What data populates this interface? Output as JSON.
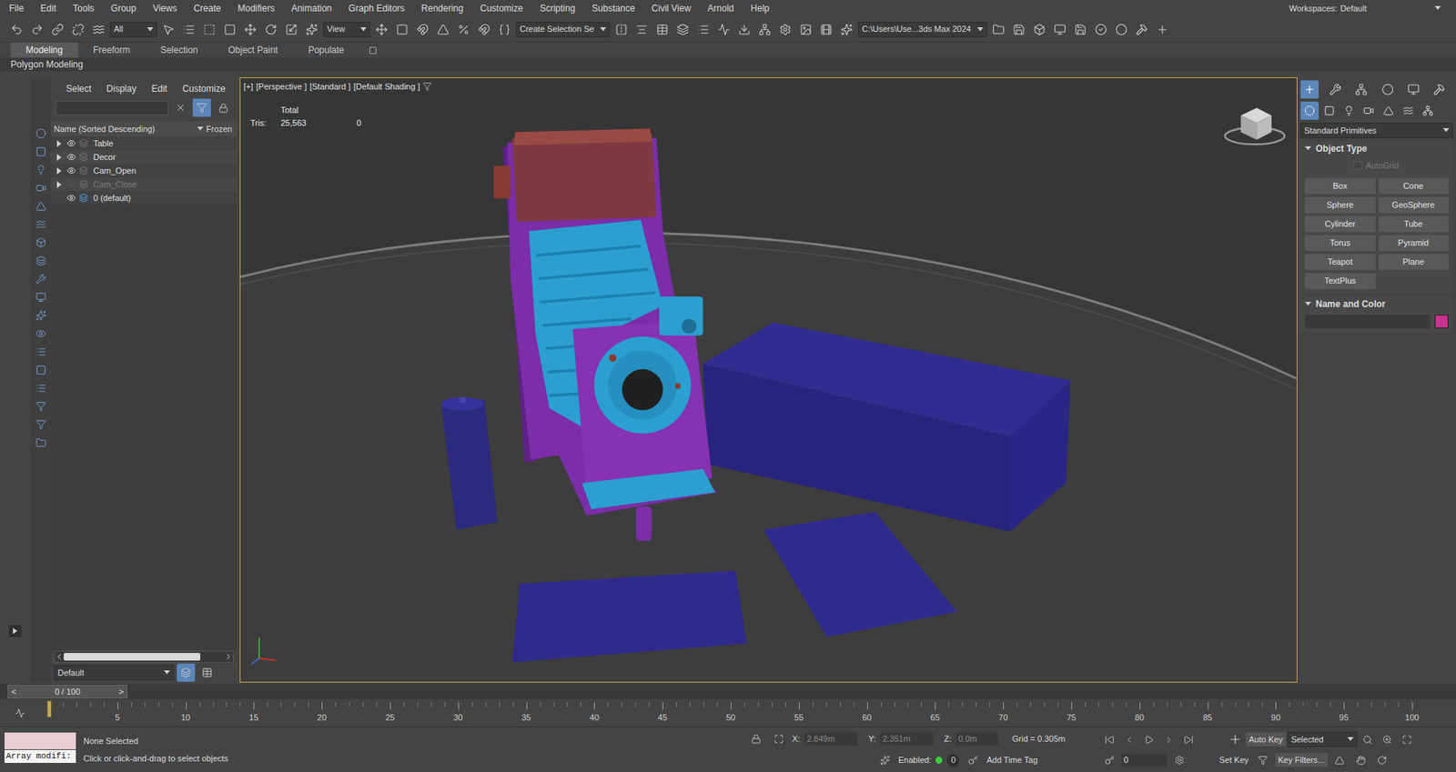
{
  "menu_bar": {
    "items": [
      "File",
      "Edit",
      "Tools",
      "Group",
      "Views",
      "Create",
      "Modifiers",
      "Animation",
      "Graph Editors",
      "Rendering",
      "Customize",
      "Scripting",
      "Substance",
      "Civil View",
      "Arnold",
      "Help"
    ],
    "workspaces_label": "Workspaces:",
    "workspace": "Default"
  },
  "toolbar": {
    "selection_filter": "All",
    "reference_coord": "View",
    "selection_set": "Create Selection Se",
    "project_path": "C:\\Users\\Use...3ds Max 2024"
  },
  "ribbon": {
    "tabs": [
      {
        "label": "Modeling",
        "selected": true
      },
      {
        "label": "Freeform",
        "selected": false
      },
      {
        "label": "Selection",
        "selected": false
      },
      {
        "label": "Object Paint",
        "selected": false
      },
      {
        "label": "Populate",
        "selected": false
      }
    ],
    "panel_label": "Polygon Modeling"
  },
  "scene_explorer": {
    "menu": [
      "Select",
      "Display",
      "Edit",
      "Customize"
    ],
    "search_value": "",
    "filter_active": true,
    "columns": [
      "Name (Sorted Descending)",
      "Frozen"
    ],
    "rows": [
      {
        "name": "Table",
        "kind": "object",
        "visible": true,
        "expandable": true,
        "expanded": false
      },
      {
        "name": "Decor",
        "kind": "object",
        "visible": true,
        "expandable": true,
        "expanded": false
      },
      {
        "name": "Cam_Open",
        "kind": "object",
        "visible": true,
        "expandable": true,
        "expanded": false
      },
      {
        "name": "Cam_Close",
        "kind": "object",
        "visible": false,
        "expandable": true,
        "expanded": false
      },
      {
        "name": "0 (default)",
        "kind": "layer",
        "visible": true,
        "expandable": false,
        "expanded": false
      }
    ],
    "layer_dropdown": "Default"
  },
  "viewport": {
    "labels": [
      "[+]",
      "[Perspective ]",
      "[Standard ]",
      "[Default Shading ]"
    ],
    "active": true,
    "stats": {
      "header": "Total",
      "label": "Tris:",
      "value": "25,563",
      "second_value": "0"
    }
  },
  "command_panel": {
    "category": "Standard Primitives",
    "object_type_title": "Object Type",
    "autogrid": {
      "label": "AutoGrid",
      "checked": false,
      "disabled": true
    },
    "buttons": [
      "Box",
      "Cone",
      "Sphere",
      "GeoSphere",
      "Cylinder",
      "Tube",
      "Torus",
      "Pyramid",
      "Teapot",
      "Plane",
      "TextPlus"
    ],
    "name_color_title": "Name and Color",
    "name_value": "",
    "color": "#c8318e"
  },
  "timeline": {
    "prev": "<",
    "position": "0 / 100",
    "next": ">",
    "level": 0
  },
  "trackbar": {
    "ticks": [
      "5",
      "10",
      "15",
      "20",
      "25",
      "30",
      "35",
      "40",
      "45",
      "50",
      "55",
      "60",
      "65",
      "70",
      "75",
      "80",
      "85",
      "90",
      "95",
      "100"
    ],
    "current_frame": 0
  },
  "status_bar": {
    "listener_text": "Array modifi:",
    "selection": "None Selected",
    "prompt": "Click or click-and-drag to select objects",
    "x_label": "X:",
    "x_value": "2.849m",
    "y_label": "Y:",
    "y_value": "2.351m",
    "z_label": "Z:",
    "z_value": "0.0m",
    "grid": "Grid = 0.305m",
    "enabled_label": "Enabled:",
    "enabled": true,
    "enabled_value": "0",
    "add_time_tag": "Add Time Tag",
    "auto_key": "Auto Key",
    "key_mode": "Selected",
    "set_key": "Set Key",
    "key_filters": "Key Filters...",
    "frame": "0"
  }
}
